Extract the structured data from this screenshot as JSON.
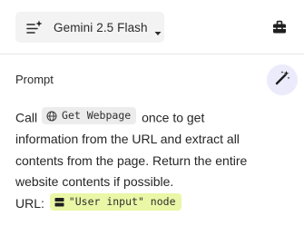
{
  "header": {
    "model_select": {
      "label": "Gemini 2.5 Flash",
      "icon": "sparkle-lines-icon",
      "caret_icon": "chevron-down-icon"
    },
    "toolbox_icon": "toolbox-icon"
  },
  "prompt": {
    "heading": "Prompt",
    "magic_icon": "magic-wand-icon",
    "line1_prefix": "Call",
    "tool_chip": {
      "icon": "globe-icon",
      "label": "Get Webpage"
    },
    "line1_suffix": "once to get",
    "line2": "information from the URL and extract all",
    "line3": "contents from the page. Return the entire",
    "line4": "website contents if possible.",
    "url_label": "URL:",
    "node_chip": {
      "icon": "input-node-icon",
      "label": "\"User input\" node"
    }
  },
  "colors": {
    "model_select_bg": "#f3f3f4",
    "magic_button_bg": "#ecebfb",
    "tool_chip_bg": "#ececec",
    "node_chip_bg": "#eaf7a6"
  }
}
